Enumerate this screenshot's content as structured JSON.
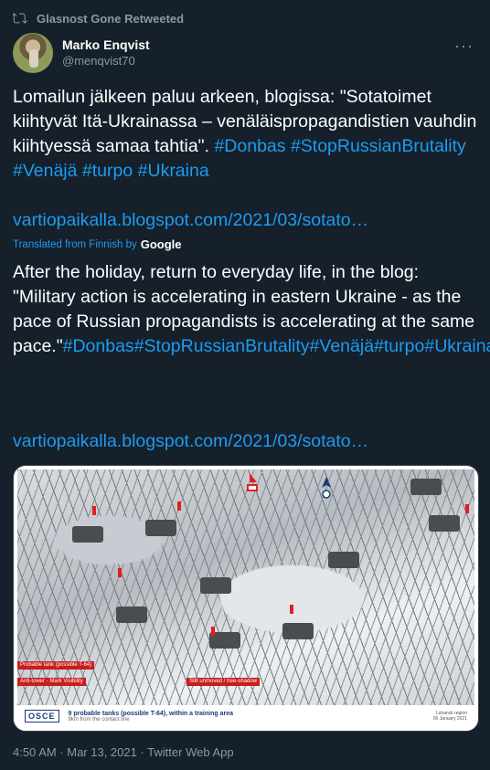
{
  "retweet": {
    "label": "Glasnost Gone Retweeted"
  },
  "author": {
    "display_name": "Marko Enqvist",
    "handle": "@menqvist70"
  },
  "more_label": "···",
  "tweet": {
    "original_text": "Lomailun jälkeen paluu arkeen, blogissa: \"Sotatoimet kiihtyvät Itä-Ukrainassa – venäläispropagandistien vauhdin kiihtyessä samaa tahtia\".",
    "original_tags": [
      "#Donbas",
      "#StopRussianBrutality",
      "#Venäjä",
      "#turpo",
      "#Ukraina"
    ],
    "link_1": "vartiopaikalla.blogspot.com/2021/03/sotato…",
    "translated_from": "Translated from Finnish by",
    "translator": "Google",
    "translated_text": "After the holiday, return to everyday life, in the blog: \"Military action is accelerating in eastern Ukraine - as the pace of Russian propagandists is accelerating at the same pace.\"",
    "translated_tags": [
      "#Donbas",
      "#StopRussianBrutality",
      "#Venäjä",
      "#turpo",
      "#Ukraina"
    ],
    "link_2": "vartiopaikalla.blogspot.com/2021/03/sotato…"
  },
  "media": {
    "org": "OSCE",
    "caption_title": "9 probable tanks (possible T-64), within a training area",
    "caption_sub": "9km from the contact line",
    "caption_right": [
      "Luhansk region",
      "06 January 2021"
    ],
    "labels": [
      "Probable tank (possible T-64)",
      "Anti-tower - Mark Visibility",
      "Still unmoved / tree-shadow"
    ]
  },
  "timestamp": "4:50 AM · Mar 13, 2021 · Twitter Web App"
}
